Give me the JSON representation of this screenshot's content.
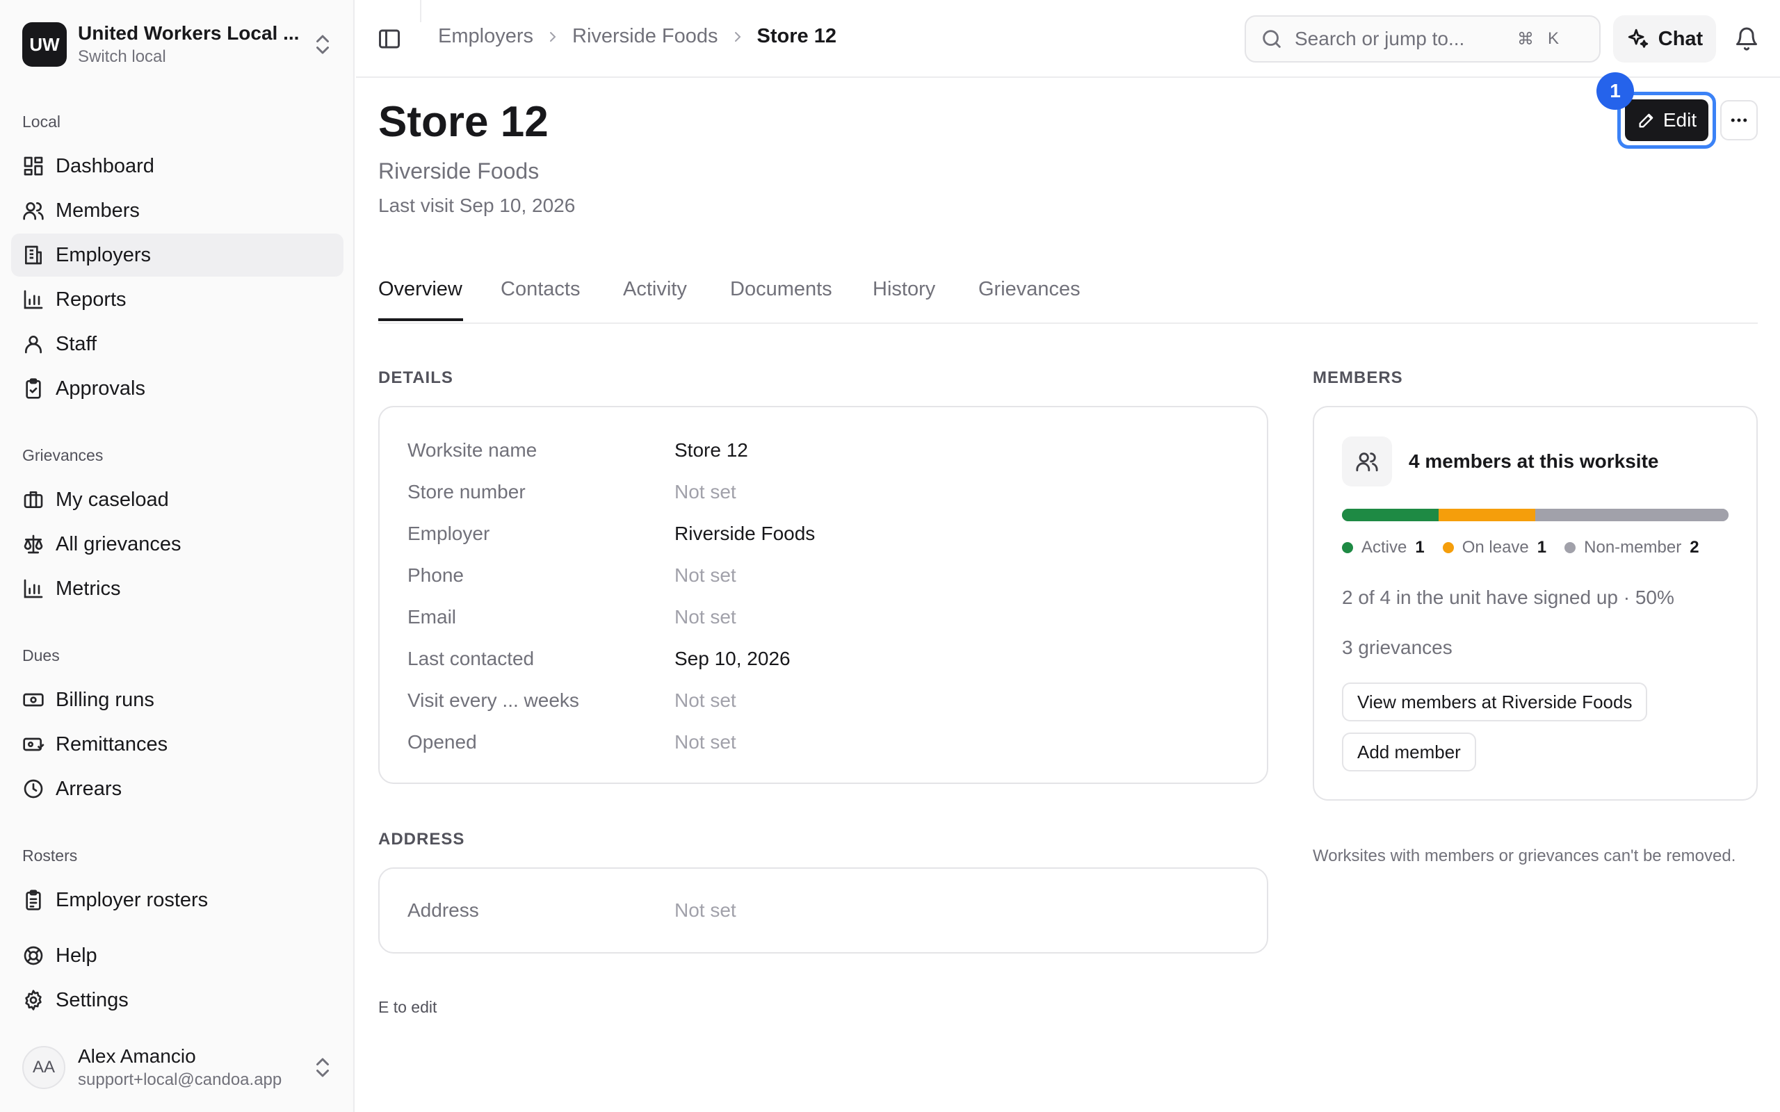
{
  "org": {
    "initials": "UW",
    "name": "United Workers Local ...",
    "switch_label": "Switch local"
  },
  "nav": {
    "sections": [
      {
        "title": "Local",
        "items": [
          {
            "label": "Dashboard",
            "icon": "dashboard-icon"
          },
          {
            "label": "Members",
            "icon": "users-icon"
          },
          {
            "label": "Employers",
            "icon": "building-icon",
            "active": true
          },
          {
            "label": "Reports",
            "icon": "bar-chart-icon"
          },
          {
            "label": "Staff",
            "icon": "user-icon"
          },
          {
            "label": "Approvals",
            "icon": "clipboard-check-icon"
          }
        ]
      },
      {
        "title": "Grievances",
        "items": [
          {
            "label": "My caseload",
            "icon": "briefcase-icon"
          },
          {
            "label": "All grievances",
            "icon": "scale-icon"
          },
          {
            "label": "Metrics",
            "icon": "bar-chart-icon"
          }
        ]
      },
      {
        "title": "Dues",
        "items": [
          {
            "label": "Billing runs",
            "icon": "banknote-icon"
          },
          {
            "label": "Remittances",
            "icon": "wallet-icon"
          },
          {
            "label": "Arrears",
            "icon": "clock-icon"
          }
        ]
      },
      {
        "title": "Rosters",
        "items": [
          {
            "label": "Employer rosters",
            "icon": "clipboard-list-icon"
          }
        ]
      }
    ],
    "footer_items": [
      {
        "label": "Help",
        "icon": "lifebuoy-icon"
      },
      {
        "label": "Settings",
        "icon": "gear-icon"
      }
    ]
  },
  "user": {
    "initials": "AA",
    "name": "Alex Amancio",
    "email": "support+local@candoa.app"
  },
  "topbar": {
    "breadcrumbs": [
      "Employers",
      "Riverside Foods",
      "Store 12"
    ],
    "search_placeholder": "Search or jump to...",
    "shortcut_key1": "⌘",
    "shortcut_key2": "K",
    "chat_label": "Chat"
  },
  "header": {
    "title": "Store 12",
    "subtitle": "Riverside Foods",
    "last_visit": "Last visit Sep 10, 2026",
    "edit_label": "Edit",
    "badge": "1"
  },
  "tabs": [
    "Overview",
    "Contacts",
    "Activity",
    "Documents",
    "History",
    "Grievances"
  ],
  "details": {
    "heading": "DETAILS",
    "fields": [
      {
        "label": "Worksite name",
        "value": "Store 12",
        "empty": false
      },
      {
        "label": "Store number",
        "value": "Not set",
        "empty": true
      },
      {
        "label": "Employer",
        "value": "Riverside Foods",
        "empty": false
      },
      {
        "label": "Phone",
        "value": "Not set",
        "empty": true
      },
      {
        "label": "Email",
        "value": "Not set",
        "empty": true
      },
      {
        "label": "Last contacted",
        "value": "Sep 10, 2026",
        "empty": false
      },
      {
        "label": "Visit every ... weeks",
        "value": "Not set",
        "empty": true
      },
      {
        "label": "Opened",
        "value": "Not set",
        "empty": true
      }
    ]
  },
  "address": {
    "heading": "ADDRESS",
    "label": "Address",
    "value": "Not set"
  },
  "hint": "E to edit",
  "members": {
    "heading": "MEMBERS",
    "title": "4 members at this worksite",
    "breakdown": [
      {
        "name": "Active",
        "count": "1",
        "share": 0.25,
        "color": "#1e8a44"
      },
      {
        "name": "On leave",
        "count": "1",
        "share": 0.25,
        "color": "#f59e0b"
      },
      {
        "name": "Non-member",
        "count": "2",
        "share": 0.5,
        "color": "#a1a1aa"
      }
    ],
    "signup_line": "2 of 4 in the unit have signed up · 50%",
    "grievances_line": "3 grievances",
    "view_button": "View members at Riverside Foods",
    "add_button": "Add member",
    "removal_note": "Worksites with members or grievances can't be removed."
  }
}
